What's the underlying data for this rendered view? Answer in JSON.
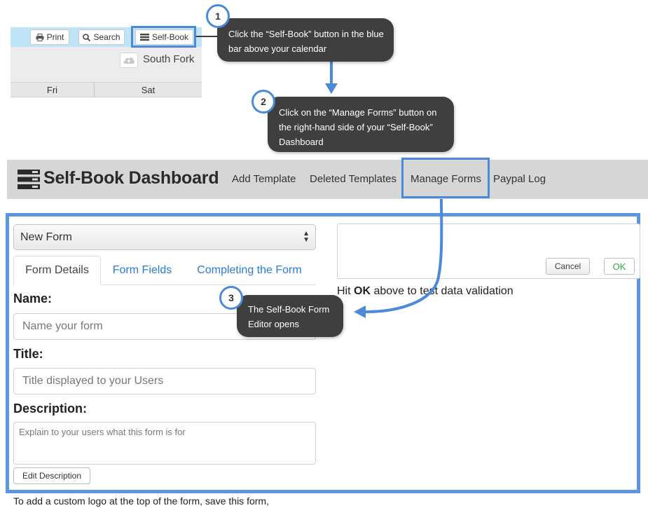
{
  "calendar": {
    "print_label": "Print",
    "search_label": "Search",
    "selfbook_label": "Self-Book",
    "location": "South Fork",
    "days": [
      "Fri",
      "Sat"
    ]
  },
  "callouts": {
    "step1": {
      "number": "1",
      "text": "Click the “Self-Book” button in the blue bar above your calendar"
    },
    "step2": {
      "number": "2",
      "text": "Click on the “Manage Forms” button on the right-hand side of your “Self-Book” Dashboard"
    },
    "step3": {
      "number": "3",
      "text": "The Self-Book Form Editor opens"
    }
  },
  "dashboard": {
    "title": "Self-Book Dashboard",
    "nav": [
      "Add Template",
      "Deleted Templates",
      "Manage Forms",
      "Paypal Log"
    ]
  },
  "form_editor": {
    "select_value": "New Form",
    "tabs": [
      "Form Details",
      "Form Fields",
      "Completing the Form"
    ],
    "name_label": "Name:",
    "name_placeholder": "Name your form",
    "title_label": "Title:",
    "title_placeholder": "Title displayed to your Users",
    "description_label": "Description:",
    "description_placeholder": "Explain to your users what this form is for",
    "edit_description_label": "Edit Description",
    "preview": {
      "cancel_label": "Cancel",
      "ok_label": "OK",
      "validation_prefix": "Hit ",
      "validation_bold": "OK",
      "validation_suffix": " above to test data validation"
    }
  },
  "footer_text": "To add a custom logo at the top of the form, save this form,",
  "colors": {
    "highlight": "#4b8ad8",
    "callout_bg": "#3f3f3f",
    "calendar_bar": "#bfe3f7",
    "tab_link": "#2a7bd4",
    "ok_text": "#2aa84a"
  }
}
